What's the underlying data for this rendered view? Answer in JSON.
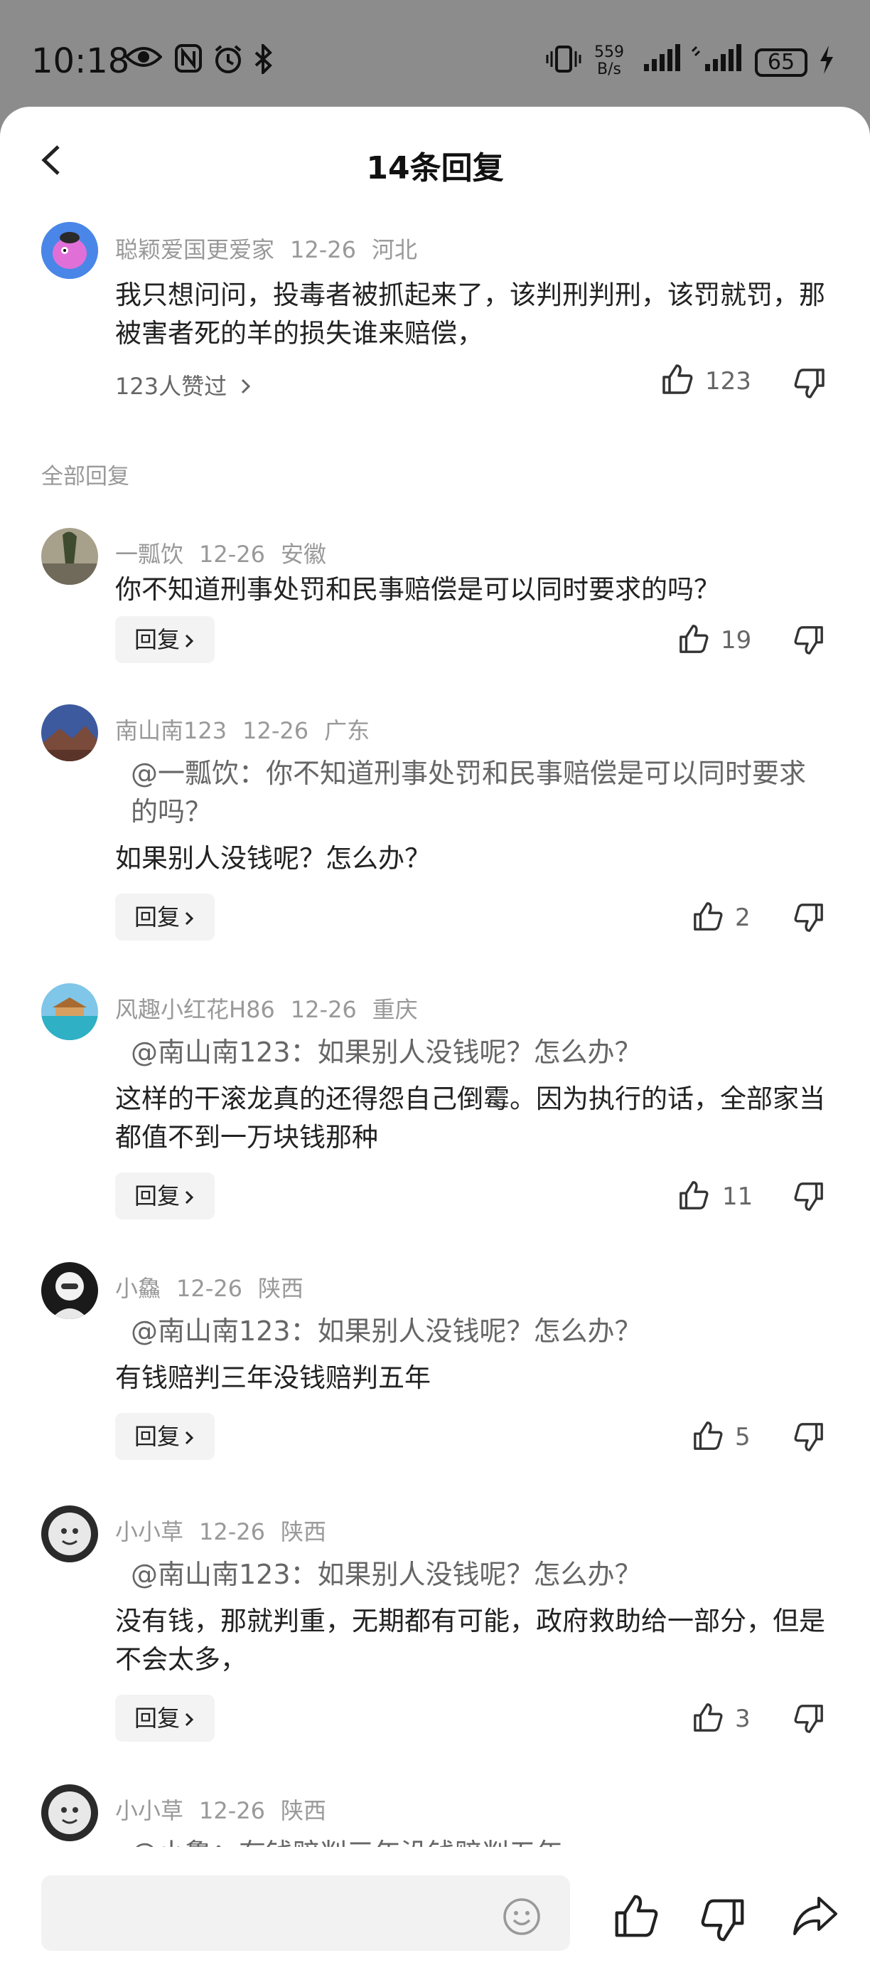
{
  "status": {
    "time": "10:18",
    "net_speed_value": "559",
    "net_speed_unit": "B/s",
    "battery": "65"
  },
  "header": {
    "title": "14条回复"
  },
  "main_comment": {
    "user": "聪颖爱国更爱家",
    "date": "12-26",
    "location": "河北",
    "text": "我只想问问，投毒者被抓起来了，该判刑判刑，该罚就罚，那被害者死的羊的损失谁来赔偿，",
    "likers": "123人赞过",
    "likes": "123"
  },
  "section_label": "全部回复",
  "reply_label": "回复",
  "replies": [
    {
      "user": "一瓢饮",
      "date": "12-26",
      "location": "安徽",
      "quote": "",
      "text": "你不知道刑事处罚和民事赔偿是可以同时要求的吗？",
      "likes": "19"
    },
    {
      "user": "南山南123",
      "date": "12-26",
      "location": "广东",
      "quote": "@一瓢饮：你不知道刑事处罚和民事赔偿是可以同时要求的吗？",
      "text": "如果别人没钱呢？怎么办？",
      "likes": "2"
    },
    {
      "user": "风趣小红花H86",
      "date": "12-26",
      "location": "重庆",
      "quote": "@南山南123：如果别人没钱呢？怎么办？",
      "text": "这样的干滚龙真的还得怨自己倒霉。因为执行的话，全部家当都值不到一万块钱那种",
      "likes": "11"
    },
    {
      "user": "小鱻",
      "date": "12-26",
      "location": "陕西",
      "quote": "@南山南123：如果别人没钱呢？怎么办？",
      "text": "有钱赔判三年没钱赔判五年",
      "likes": "5"
    },
    {
      "user": "小小草",
      "date": "12-26",
      "location": "陕西",
      "quote": "@南山南123：如果别人没钱呢？怎么办？",
      "text": "没有钱，那就判重，无期都有可能，政府救助给一部分，但是不会太多，",
      "likes": "3"
    },
    {
      "user": "小小草",
      "date": "12-26",
      "location": "陕西",
      "quote": "@小鱻：有钱赔判三年没钱赔判五年",
      "text": "",
      "likes": ""
    }
  ],
  "bottom": {
    "input_placeholder": ""
  }
}
